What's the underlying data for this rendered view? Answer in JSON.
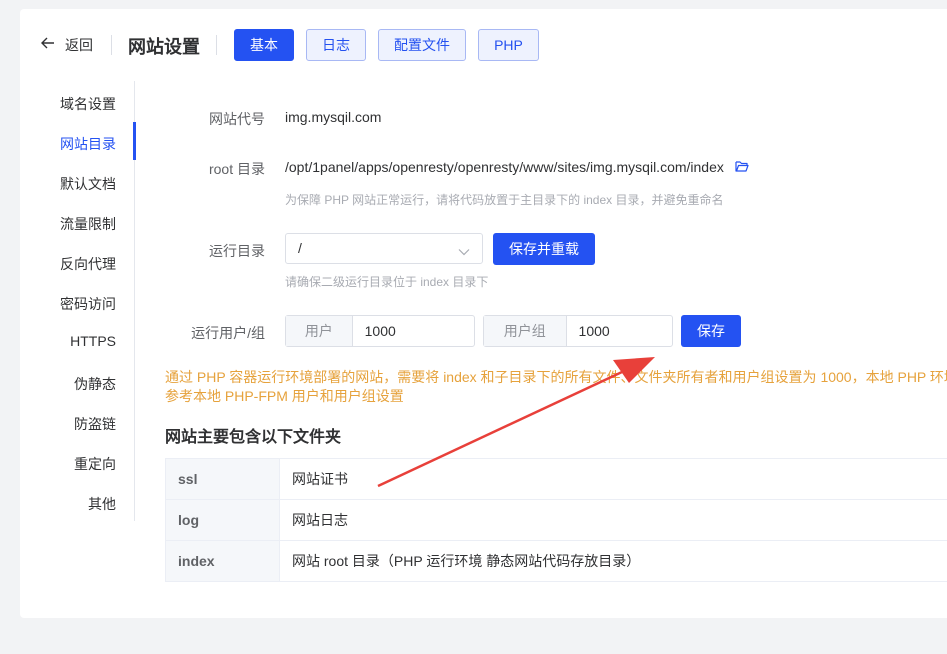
{
  "header": {
    "back_label": "返回",
    "title": "网站设置",
    "tabs": [
      {
        "label": "基本",
        "active": true
      },
      {
        "label": "日志",
        "active": false
      },
      {
        "label": "配置文件",
        "active": false
      },
      {
        "label": "PHP",
        "active": false
      }
    ]
  },
  "menu": {
    "items": [
      "域名设置",
      "网站目录",
      "默认文档",
      "流量限制",
      "反向代理",
      "密码访问",
      "HTTPS",
      "伪静态",
      "防盗链",
      "重定向",
      "其他"
    ],
    "active_index": 1
  },
  "form": {
    "site_code_label": "网站代号",
    "site_code": "img.mysqil.com",
    "root_label": "root 目录",
    "root_path": "/opt/1panel/apps/openresty/openresty/www/sites/img.mysqil.com/index",
    "root_hint": "为保障 PHP 网站正常运行，请将代码放置于主目录下的 index 目录，并避免重命名",
    "run_dir_label": "运行目录",
    "run_dir_value": "/",
    "save_reload_label": "保存并重载",
    "run_dir_hint": "请确保二级运行目录位于 index 目录下",
    "run_user_label": "运行用户/组",
    "user_prefix": "用户",
    "user_value": "1000",
    "group_prefix": "用户组",
    "group_value": "1000",
    "save_label": "保存"
  },
  "warning": {
    "line1": "通过 PHP 容器运行环境部署的网站，需要将 index 和子目录下的所有文件、文件夹所有者和用户组设置为 1000，本地 PHP 环境",
    "line2": "参考本地 PHP-FPM 用户和用户组设置"
  },
  "folders": {
    "title": "网站主要包含以下文件夹",
    "rows": [
      {
        "name": "ssl",
        "desc": "网站证书"
      },
      {
        "name": "log",
        "desc": "网站日志"
      },
      {
        "name": "index",
        "desc": "网站 root 目录（PHP 运行环境 静态网站代码存放目录）"
      }
    ]
  },
  "colors": {
    "primary": "#2452f2",
    "warning": "#e6a23c",
    "annotation_arrow": "#e8403a"
  }
}
